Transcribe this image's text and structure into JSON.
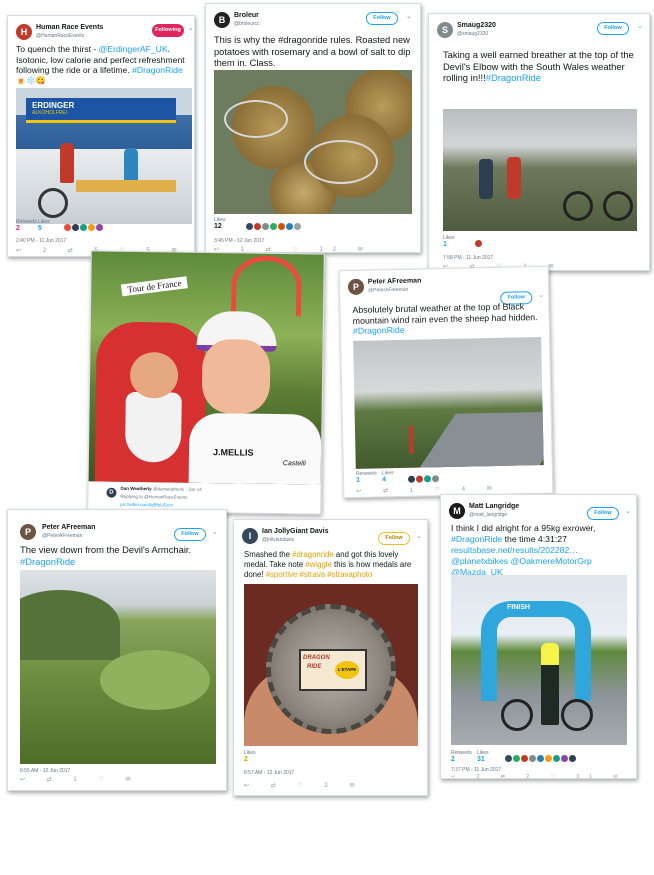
{
  "tweets": {
    "hre": {
      "name": "Human Race Events",
      "handle": "@HumanRaceEvents",
      "follow": "Following",
      "text_a": "To quench the thirst - ",
      "mention": "@ErdingerAF_UK",
      "text_b": ". Isotonic, low calorie and perfect refreshment following the ride or a lifetime. ",
      "hashtag": "#DragonRide",
      "emoji": "🍺❄️😋",
      "banner_top": "ERDINGER",
      "banner_sub": "ALKOHOLFREI",
      "retweets_label": "Retweets",
      "retweets": "2",
      "likes_label": "Likes",
      "likes": "5",
      "time": "2:40 PM - 11 Jun 2017",
      "actions": "↩ 2 ⇄ 5 ♡ 5 ✉"
    },
    "broleur": {
      "name": "Broleur",
      "handle": "@broleurcc",
      "follow": "Follow",
      "text": "This is why the #dragonride rules. Roasted new potatoes with rosemary and a bowl of salt to dip them in. Class.",
      "likes_label": "Likes",
      "likes": "12",
      "time": "3:45 PM - 12 Jun 2017",
      "actions": "↩ 1 ⇄ ♡ 12 ✉"
    },
    "smaug": {
      "name": "Smaug2320",
      "handle": "@smaug2320",
      "follow": "Follow",
      "text_a": "Taking a well earned breather at the top of the Devil's Elbow with the South Wales weather rolling in!!!",
      "hashtag": "#DragonRide",
      "likes_label": "Likes",
      "likes": "1",
      "time": "7:58 PM - 11 Jun 2017",
      "actions": "↩ ⇄ ♡ 1 ✉"
    },
    "devil": {
      "banner": "Tour de France",
      "author": "Dan Weatherly",
      "handle": "@danweatherly · Jun 14",
      "reply": "Replying to @HumanRaceEvents",
      "link": "pic.twitter.com/bjBfbUGvm",
      "jersey": "J.MELLIS",
      "sub": "Castelli"
    },
    "peter1": {
      "name": "Peter AFreeman",
      "handle": "@PeterAFreeman",
      "follow": "Follow",
      "text_a": "Absolutely brutal weather at the top of Black mountain wind rain even the sheep had hidden. ",
      "hashtag": "#DragonRide",
      "retweets_label": "Retweets",
      "retweets": "1",
      "likes_label": "Likes",
      "likes": "4",
      "actions": "↩ ⇄ 1 ♡ 4 ✉"
    },
    "peter2": {
      "name": "Peter AFreeman",
      "handle": "@PeterAFreeman",
      "follow": "Follow",
      "text_a": "The view down from the Devil's Armchair.",
      "hashtag": "#DragonRide",
      "time": "8:55 AM - 12 Jun 2017",
      "actions": "↩ ⇄ 1 ♡ ✉"
    },
    "ian": {
      "name": "Ian JollyGiant Davis",
      "handle": "@jollyiandavis",
      "follow": "Follow",
      "t1": "Smashed the ",
      "h1": "#dragonride",
      "t2": " and got this lovely medal. Take note ",
      "h2": "#wiggle",
      "t3": " this is how medals are done! ",
      "h3": "#sportive #strava #stravaphoto",
      "medal_a": "DRAGON",
      "medal_b": "RIDE",
      "medal_c": "L'ETAPE",
      "likes_label": "Likes",
      "likes": "2",
      "time": "8:57 AM - 12 Jun 2017",
      "actions": "↩ ⇄ ♡ 2 ✉"
    },
    "matt": {
      "name": "Matt Langridge",
      "handle": "@matt_langridge",
      "follow": "Follow",
      "text_a": "I think I did alright for a 95kg exrower, ",
      "hashtag": "#DragonRide",
      "text_b": " the time 4:31:27",
      "link": "resultsbase.net/results/202282…",
      "mentions": "@planetxbikes @OakmereMotorGrp @Mazda_UK",
      "arch": "FINISH",
      "retweets_label": "Retweets",
      "retweets": "2",
      "likes_label": "Likes",
      "likes": "31",
      "time": "7:37 PM - 11 Jun 2017",
      "actions": "↩ 2 ⇄ 2 ♡ 31 ✉"
    }
  },
  "colors": {
    "link": "#1da1f2",
    "like_red": "#e0245e",
    "follow_red": "#e0245e"
  }
}
